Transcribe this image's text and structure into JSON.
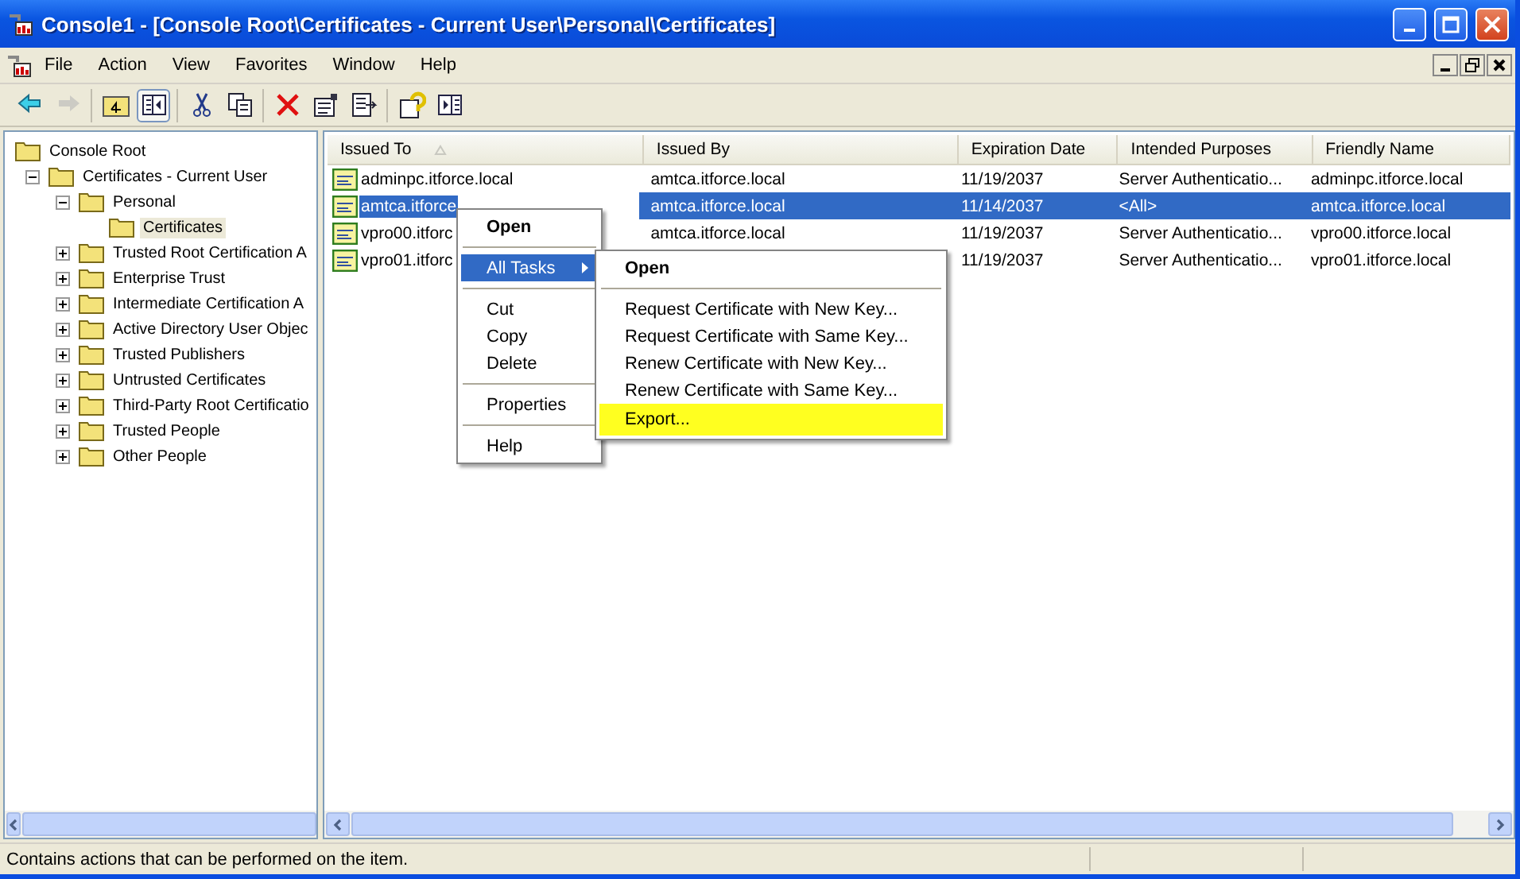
{
  "window": {
    "title": "Console1 - [Console Root\\Certificates - Current User\\Personal\\Certificates]"
  },
  "menu_bar": [
    "File",
    "Action",
    "View",
    "Favorites",
    "Window",
    "Help"
  ],
  "toolbar": [
    [
      {
        "kind": "back",
        "disabled": false
      },
      {
        "kind": "forward",
        "disabled": true
      }
    ],
    [
      {
        "kind": "up",
        "pressed": false
      },
      {
        "kind": "tree",
        "pressed": true
      }
    ],
    [
      {
        "kind": "cut",
        "pressed": false
      },
      {
        "kind": "copy",
        "pressed": false
      }
    ],
    [
      {
        "kind": "delete",
        "pressed": false
      },
      {
        "kind": "properties",
        "pressed": false
      },
      {
        "kind": "export",
        "pressed": false
      }
    ],
    [
      {
        "kind": "help",
        "pressed": false
      },
      {
        "kind": "pane",
        "pressed": false
      }
    ]
  ],
  "tree": [
    {
      "label": "Console Root",
      "selected": false,
      "children": [
        {
          "label": "Certificates - Current User",
          "expanded": true,
          "selected": false,
          "children": [
            {
              "label": "Personal",
              "expanded": true,
              "selected": false,
              "children": [
                {
                  "label": "Certificates",
                  "selected": true
                }
              ]
            },
            {
              "label": "Trusted Root Certification A",
              "expanded": false,
              "selected": false
            },
            {
              "label": "Enterprise Trust",
              "expanded": false,
              "selected": false
            },
            {
              "label": "Intermediate Certification A",
              "expanded": false,
              "selected": false
            },
            {
              "label": "Active Directory User Objec",
              "expanded": false,
              "selected": false
            },
            {
              "label": "Trusted Publishers",
              "expanded": false,
              "selected": false
            },
            {
              "label": "Untrusted Certificates",
              "expanded": false,
              "selected": false
            },
            {
              "label": "Third-Party Root Certificatio",
              "expanded": false,
              "selected": false
            },
            {
              "label": "Trusted People",
              "expanded": false,
              "selected": false
            },
            {
              "label": "Other People",
              "expanded": false,
              "selected": false
            }
          ]
        }
      ]
    }
  ],
  "table": {
    "columns": [
      {
        "label": "Issued To",
        "sorted": true
      },
      {
        "label": "Issued By",
        "sorted": false
      },
      {
        "label": "Expiration Date",
        "sorted": false
      },
      {
        "label": "Intended Purposes",
        "sorted": false
      },
      {
        "label": "Friendly Name",
        "sorted": false
      }
    ],
    "rows": [
      {
        "cells": [
          "adminpc.itforce.local",
          "amtca.itforce.local",
          "11/19/2037",
          "Server Authenticatio...",
          "adminpc.itforce.local"
        ],
        "selected": false
      },
      {
        "cells": [
          "amtca.itforce",
          "amtca.itforce.local",
          "11/14/2037",
          "<All>",
          "amtca.itforce.local"
        ],
        "selected": true
      },
      {
        "cells": [
          "vpro00.itforc",
          "amtca.itforce.local",
          "11/19/2037",
          "Server Authenticatio...",
          "vpro00.itforce.local"
        ],
        "selected": false
      },
      {
        "cells": [
          "vpro01.itforc",
          null,
          "11/19/2037",
          "Server Authenticatio...",
          "vpro01.itforce.local"
        ],
        "selected": false
      }
    ]
  },
  "context_menu": {
    "groups": [
      [
        {
          "label": "Open",
          "default": true,
          "selected": false,
          "submenu": false
        }
      ],
      [
        {
          "label": "All Tasks",
          "default": false,
          "selected": true,
          "submenu": true
        }
      ],
      [
        {
          "label": "Cut",
          "default": false,
          "selected": false,
          "submenu": false
        },
        {
          "label": "Copy",
          "default": false,
          "selected": false,
          "submenu": false
        },
        {
          "label": "Delete",
          "default": false,
          "selected": false,
          "submenu": false
        }
      ],
      [
        {
          "label": "Properties",
          "default": false,
          "selected": false,
          "submenu": false
        }
      ],
      [
        {
          "label": "Help",
          "default": false,
          "selected": false,
          "submenu": false
        }
      ]
    ]
  },
  "submenu": {
    "groups": [
      [
        {
          "label": "Open",
          "default": true,
          "marked": false
        }
      ],
      [
        {
          "label": "Request Certificate with New Key...",
          "default": false,
          "marked": false
        },
        {
          "label": "Request Certificate with Same Key...",
          "default": false,
          "marked": false
        },
        {
          "label": "Renew Certificate with New Key...",
          "default": false,
          "marked": false
        },
        {
          "label": "Renew Certificate with Same Key...",
          "default": false,
          "marked": false
        },
        {
          "label": "Export...",
          "default": false,
          "marked": true
        }
      ]
    ]
  },
  "status_bar": {
    "text": "Contains actions that can be performed on the item."
  }
}
